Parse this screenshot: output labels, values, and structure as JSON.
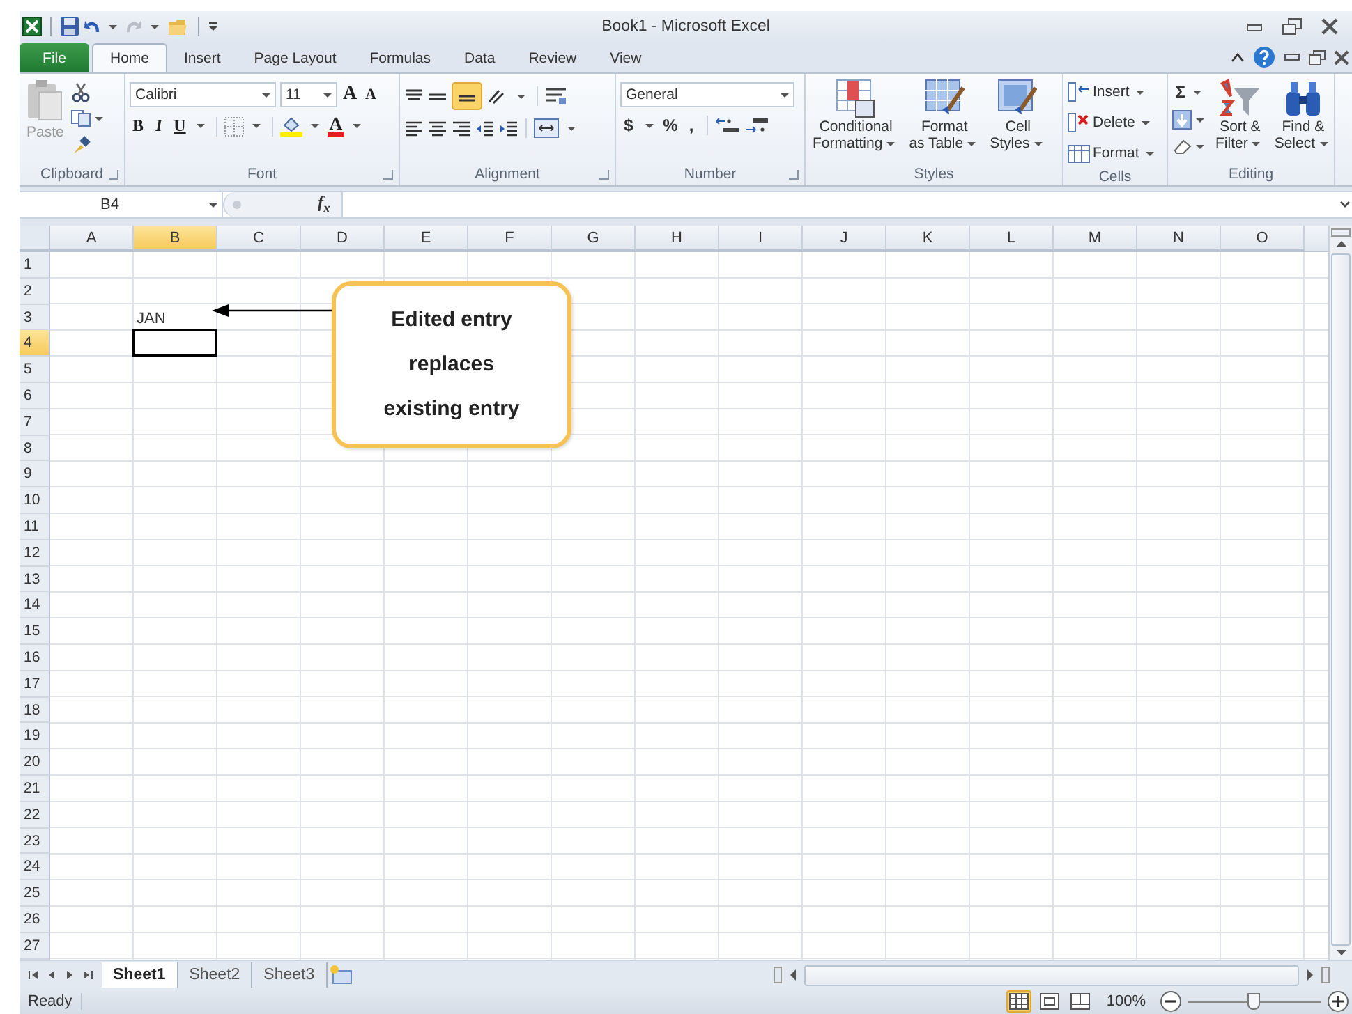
{
  "window": {
    "title": "Book1 - Microsoft Excel"
  },
  "tabs": [
    {
      "label": "File",
      "kind": "file",
      "selected": false
    },
    {
      "label": "Home",
      "kind": "tab",
      "selected": true
    },
    {
      "label": "Insert",
      "kind": "tab",
      "selected": false
    },
    {
      "label": "Page Layout",
      "kind": "tab",
      "selected": false
    },
    {
      "label": "Formulas",
      "kind": "tab",
      "selected": false
    },
    {
      "label": "Data",
      "kind": "tab",
      "selected": false
    },
    {
      "label": "Review",
      "kind": "tab",
      "selected": false
    },
    {
      "label": "View",
      "kind": "tab",
      "selected": false
    }
  ],
  "ribbon": {
    "clipboard": {
      "label": "Clipboard",
      "paste": "Paste"
    },
    "font": {
      "label": "Font",
      "name": "Calibri",
      "size": "11",
      "grow": "A",
      "shrink": "A",
      "bold": "B",
      "italic": "I",
      "underline": "U",
      "color_button": "A"
    },
    "alignment": {
      "label": "Alignment"
    },
    "number": {
      "label": "Number",
      "format": "General",
      "currency": "$",
      "percent": "%",
      "comma": ","
    },
    "styles": {
      "label": "Styles",
      "buttons": [
        {
          "kind": "conditional",
          "lines": [
            "Conditional",
            "Formatting"
          ]
        },
        {
          "kind": "table",
          "lines": [
            "Format",
            "as Table"
          ]
        },
        {
          "kind": "cellstyles",
          "lines": [
            "Cell",
            "Styles"
          ]
        }
      ]
    },
    "cells": {
      "label": "Cells",
      "buttons": [
        {
          "kind": "insert",
          "label": "Insert"
        },
        {
          "kind": "delete",
          "label": "Delete"
        },
        {
          "kind": "format",
          "label": "Format"
        }
      ]
    },
    "editing": {
      "label": "Editing",
      "sum": "Σ",
      "buttons": [
        {
          "kind": "sort",
          "lines": [
            "Sort &",
            "Filter"
          ]
        },
        {
          "kind": "find",
          "lines": [
            "Find &",
            "Select"
          ]
        }
      ]
    }
  },
  "formula_bar": {
    "name_box": "B4",
    "fx": "f$_{x}$"
  },
  "columns": [
    {
      "label": "A",
      "selected": false
    },
    {
      "label": "B",
      "selected": true
    },
    {
      "label": "C",
      "selected": false
    },
    {
      "label": "D",
      "selected": false
    },
    {
      "label": "E",
      "selected": false
    },
    {
      "label": "F",
      "selected": false
    },
    {
      "label": "G",
      "selected": false
    },
    {
      "label": "H",
      "selected": false
    },
    {
      "label": "I",
      "selected": false
    },
    {
      "label": "J",
      "selected": false
    },
    {
      "label": "K",
      "selected": false
    },
    {
      "label": "L",
      "selected": false
    },
    {
      "label": "M",
      "selected": false
    },
    {
      "label": "N",
      "selected": false
    },
    {
      "label": "O",
      "selected": false
    }
  ],
  "rows": [
    {
      "label": "1",
      "selected": false
    },
    {
      "label": "2",
      "selected": false
    },
    {
      "label": "3",
      "selected": false,
      "cells": [
        null,
        {
          "value": "JAN",
          "selected": false
        }
      ]
    },
    {
      "label": "4",
      "selected": true,
      "cells": [
        null,
        {
          "selected": true
        }
      ]
    },
    {
      "label": "5",
      "selected": false
    },
    {
      "label": "6",
      "selected": false
    },
    {
      "label": "7",
      "selected": false
    },
    {
      "label": "8",
      "selected": false
    },
    {
      "label": "9",
      "selected": false
    },
    {
      "label": "10",
      "selected": false
    },
    {
      "label": "11",
      "selected": false
    },
    {
      "label": "12",
      "selected": false
    },
    {
      "label": "13",
      "selected": false
    },
    {
      "label": "14",
      "selected": false
    },
    {
      "label": "15",
      "selected": false
    },
    {
      "label": "16",
      "selected": false
    },
    {
      "label": "17",
      "selected": false
    },
    {
      "label": "18",
      "selected": false
    },
    {
      "label": "19",
      "selected": false
    },
    {
      "label": "20",
      "selected": false
    },
    {
      "label": "21",
      "selected": false
    },
    {
      "label": "22",
      "selected": false
    },
    {
      "label": "23",
      "selected": false
    },
    {
      "label": "24",
      "selected": false
    },
    {
      "label": "25",
      "selected": false
    },
    {
      "label": "26",
      "selected": false
    },
    {
      "label": "27",
      "selected": false
    }
  ],
  "callout": {
    "text": "Edited entry replaces existing entry"
  },
  "sheet_tabs": [
    {
      "label": "Sheet1",
      "selected": true
    },
    {
      "label": "Sheet2",
      "selected": false
    },
    {
      "label": "Sheet3",
      "selected": false
    }
  ],
  "status_bar": {
    "status": "Ready",
    "views": [
      {
        "kind": "normal",
        "selected": true
      },
      {
        "kind": "page_layout",
        "selected": false
      },
      {
        "kind": "page_break",
        "selected": false
      }
    ],
    "zoom": "100%",
    "zoom_slider": {
      "level": 0.5
    }
  }
}
